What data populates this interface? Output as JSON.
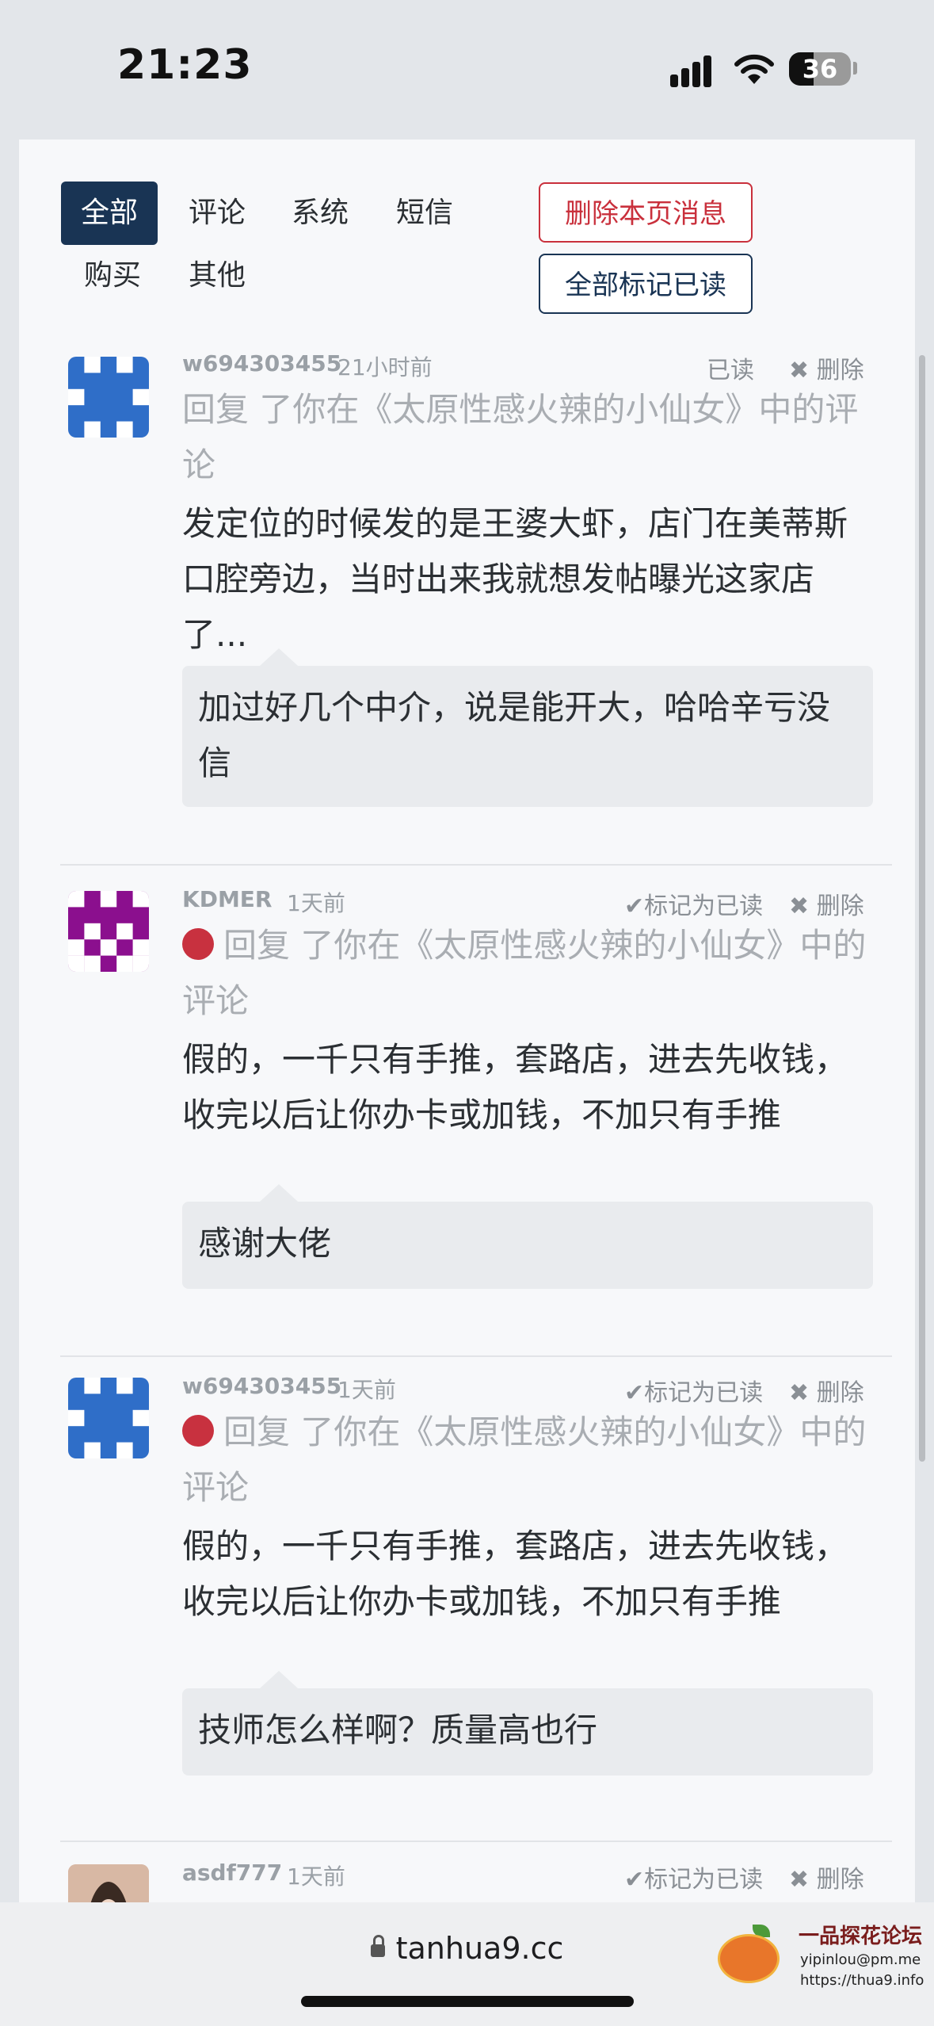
{
  "status": {
    "time": "21:23",
    "battery": "36"
  },
  "tabs": [
    {
      "label": "全部",
      "active": true
    },
    {
      "label": "评论"
    },
    {
      "label": "系统"
    },
    {
      "label": "短信"
    },
    {
      "label": "购买"
    },
    {
      "label": "其他"
    }
  ],
  "actions": {
    "delete_page": "删除本页消息",
    "mark_all_read": "全部标记已读"
  },
  "messages": [
    {
      "username": "w694303455",
      "time": "21小时前",
      "read_label": "已读",
      "delete_label": "✖ 删除",
      "title": "回复 了你在《太原性感火辣的小仙女》中的评论",
      "body": "发定位的时候发的是王婆大虾，店门在美蒂斯口腔旁边，当时出来我就想发帖曝光这家店了...",
      "quote": "加过好几个中介，说是能开大，哈哈辛亏没信"
    },
    {
      "username": "KDMER",
      "time": "1天前",
      "read_label": "✔标记为已读",
      "delete_label": "✖ 删除",
      "title": "回复 了你在《太原性感火辣的小仙女》中的评论",
      "body": "假的，一千只有手推，套路店，进去先收钱，收完以后让你办卡或加钱，不加只有手推",
      "quote": "感谢大佬"
    },
    {
      "username": "w694303455",
      "time": "1天前",
      "read_label": "✔标记为已读",
      "delete_label": "✖ 删除",
      "title": "回复 了你在《太原性感火辣的小仙女》中的评论",
      "body": "假的，一千只有手推，套路店，进去先收钱，收完以后让你办卡或加钱，不加只有手推",
      "quote": "技师怎么样啊？质量高也行"
    },
    {
      "username": "asdf777",
      "time": "1天前",
      "read_label": "✔标记为已读",
      "delete_label": "✖ 删除"
    }
  ],
  "browser": {
    "url": "tanhua9.cc"
  },
  "watermark": {
    "title": "一品探花论坛",
    "email": "yipinlou@pm.me",
    "link": "https://thua9.info"
  },
  "colors": {
    "accent": "#193454",
    "danger": "#c9303c",
    "unread_dot": "#c8313f"
  }
}
